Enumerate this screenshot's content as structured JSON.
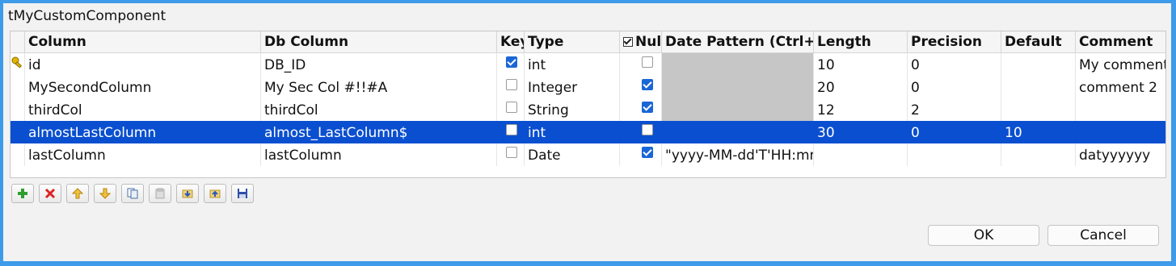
{
  "dialog": {
    "title": "tMyCustomComponent"
  },
  "table": {
    "headers": {
      "column": "Column",
      "db_column": "Db Column",
      "key": "Key",
      "type": "Type",
      "nullable": "Nullable",
      "date_pattern": "Date Pattern (Ctrl+Space)",
      "length": "Length",
      "precision": "Precision",
      "default": "Default",
      "comment": "Comment"
    },
    "rows": [
      {
        "column": "id",
        "db_column": "DB_ID",
        "key": true,
        "type": "int",
        "nullable": false,
        "date_pattern": "",
        "length": "10",
        "precision": "0",
        "default": "",
        "comment": "My comment",
        "selected": false
      },
      {
        "column": "MySecondColumn",
        "db_column": "My  Sec Col #!!#A",
        "key": false,
        "type": "Integer",
        "nullable": true,
        "date_pattern": "",
        "length": "20",
        "precision": "0",
        "default": "",
        "comment": "comment 2",
        "selected": false
      },
      {
        "column": "thirdCol",
        "db_column": "thirdCol",
        "key": false,
        "type": "String",
        "nullable": true,
        "date_pattern": "",
        "length": "12",
        "precision": "2",
        "default": "",
        "comment": "",
        "selected": false
      },
      {
        "column": "almostLastColumn",
        "db_column": "almost_LastColumn$",
        "key": false,
        "type": "int",
        "nullable": false,
        "date_pattern": "",
        "length": "30",
        "precision": "0",
        "default": "10",
        "comment": "",
        "selected": true
      },
      {
        "column": "lastColumn",
        "db_column": "lastColumn",
        "key": false,
        "type": "Date",
        "nullable": true,
        "date_pattern": "\"yyyy-MM-dd'T'HH:mm:ss\"",
        "length": "",
        "precision": "",
        "default": "",
        "comment": "datyyyyyy",
        "selected": false
      }
    ]
  },
  "toolbar": {
    "buttons": [
      "add-icon",
      "remove-icon",
      "move-up-icon",
      "move-down-icon",
      "copy-icon",
      "paste-icon",
      "import-icon",
      "export-icon",
      "save-icon"
    ]
  },
  "buttons": {
    "ok": "OK",
    "cancel": "Cancel"
  },
  "colors": {
    "selection": "#0a4fd0",
    "frame": "#3d9be9"
  }
}
